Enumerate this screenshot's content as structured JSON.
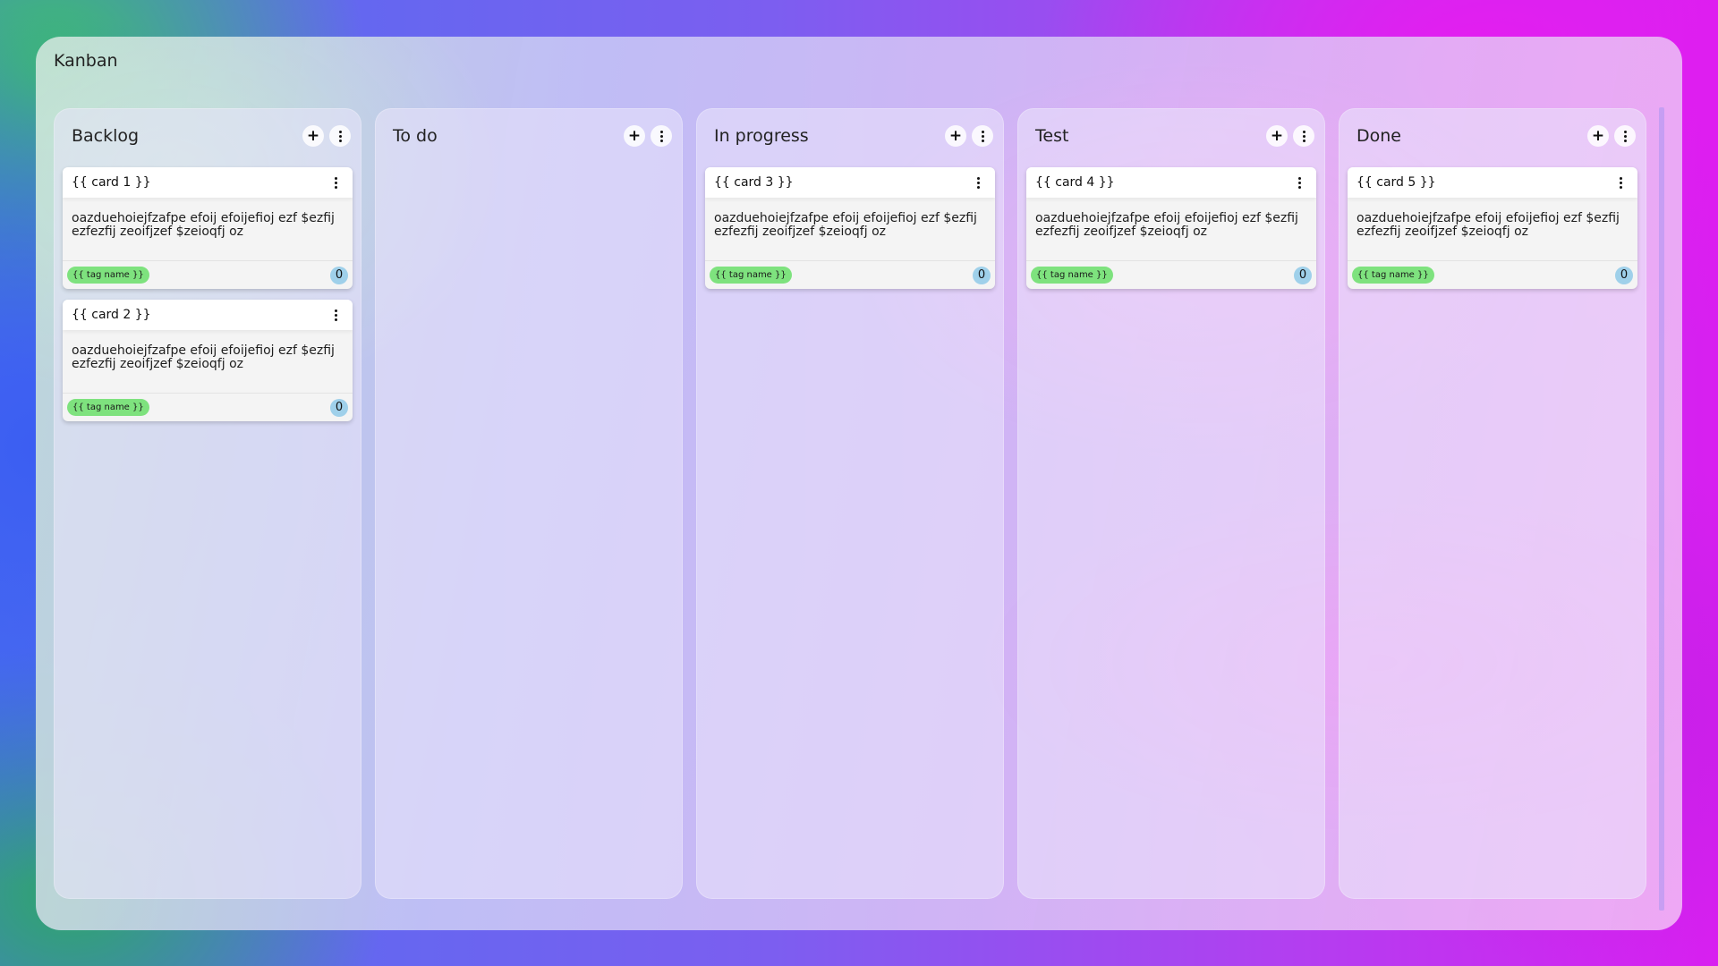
{
  "app": {
    "title": "Kanban"
  },
  "colors": {
    "tag": "#7ee27e",
    "count_badge": "#9fd0ea"
  },
  "icons": {
    "add": "plus-icon",
    "menu": "more-vertical-icon"
  },
  "columns": [
    {
      "title": "Backlog",
      "cards": [
        {
          "title": "{{ card 1 }}",
          "body": "oazduehoiejfzafpe efoij efoijefioj ezf $ezfij ezfezfij zeoifjzef $zeioqfj oz",
          "tag": "{{ tag name }}",
          "count": "0"
        },
        {
          "title": "{{ card 2 }}",
          "body": "oazduehoiejfzafpe efoij efoijefioj ezf $ezfij ezfezfij zeoifjzef $zeioqfj oz",
          "tag": "{{ tag name }}",
          "count": "0"
        }
      ]
    },
    {
      "title": "To do",
      "cards": []
    },
    {
      "title": "In progress",
      "cards": [
        {
          "title": "{{ card 3 }}",
          "body": "oazduehoiejfzafpe efoij efoijefioj ezf $ezfij ezfezfij zeoifjzef $zeioqfj oz",
          "tag": "{{ tag name }}",
          "count": "0"
        }
      ]
    },
    {
      "title": "Test",
      "cards": [
        {
          "title": "{{ card 4 }}",
          "body": "oazduehoiejfzafpe efoij efoijefioj ezf $ezfij ezfezfij zeoifjzef $zeioqfj oz",
          "tag": "{{ tag name }}",
          "count": "0"
        }
      ]
    },
    {
      "title": "Done",
      "cards": [
        {
          "title": "{{ card 5 }}",
          "body": "oazduehoiejfzafpe efoij efoijefioj ezf $ezfij ezfezfij zeoifjzef $zeioqfj oz",
          "tag": "{{ tag name }}",
          "count": "0"
        }
      ]
    }
  ]
}
